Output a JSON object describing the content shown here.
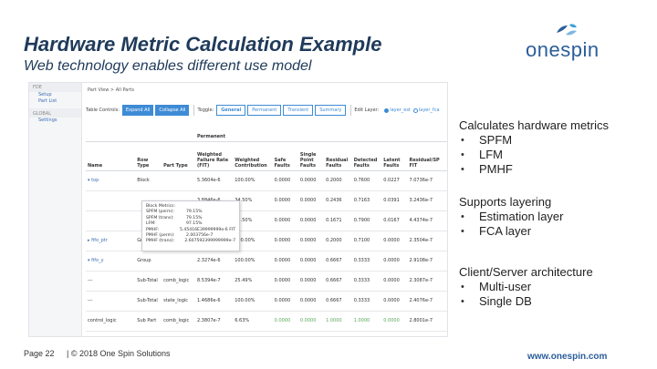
{
  "slide": {
    "title": "Hardware Metric Calculation Example",
    "subtitle": "Web technology enables different use model",
    "logo_text": "onespin",
    "footer_page": "Page  22",
    "footer_copy": "|  © 2018 One Spin Solutions",
    "footer_url": "www.onespin.com"
  },
  "right_panel": {
    "sections": [
      {
        "heading": "Calculates hardware metrics",
        "bullets": [
          "SPFM",
          "LFM",
          "PMHF"
        ]
      },
      {
        "heading": "Supports layering",
        "bullets": [
          "Estimation layer",
          "FCA  layer"
        ]
      },
      {
        "heading": "Client/Server architecture",
        "bullets": [
          "Multi-user",
          "Single DB"
        ]
      }
    ]
  },
  "app": {
    "sidebar": {
      "head": "FDE",
      "items": [
        "Setup",
        "Part List"
      ],
      "section": "GLOBAL",
      "items2": [
        "Settings"
      ]
    },
    "breadcrumb": "Part View  >  All Parts",
    "toolbar": {
      "controls_label": "Table Controls:",
      "expand_all": "Expand All",
      "collapse_all": "Collapse All",
      "toggle_label": "Toggle:",
      "toggles": [
        "General",
        "Permanent",
        "Transient",
        "Summary"
      ],
      "layer_label": "Edit Layer:",
      "layer_options": [
        "layer_est",
        "layer_fca"
      ]
    },
    "table": {
      "group_header": "Permanent",
      "columns": [
        "Name",
        "Row Type",
        "Part Type",
        "Weighted Failure Rate (FIT)",
        "Weighted Contribution",
        "Safe Faults",
        "Single Point Faults",
        "Residual Faults",
        "Detected Faults",
        "Latent Faults",
        "Residual/SP FIT"
      ],
      "rows": [
        [
          "▾  top",
          "Block",
          "",
          "5.3604e-6",
          "100.00%",
          "0.0000",
          "0.0000",
          "0.2000",
          "0.7600",
          "0.0227",
          "7.0736e-7"
        ],
        [
          "",
          "",
          "",
          "3.8846e-6",
          "34.50%",
          "0.0000",
          "0.0000",
          "0.2436",
          "0.7163",
          "0.0391",
          "3.2436e-7"
        ],
        [
          "",
          "",
          "",
          "3.6460e-6",
          "33.50%",
          "0.0000",
          "0.0000",
          "0.1671",
          "0.7900",
          "0.0167",
          "4.4374e-7"
        ],
        [
          "▸  fifo_ptr",
          "Group",
          "",
          "1.2476e-6",
          "100.00%",
          "0.0000",
          "0.0000",
          "0.2000",
          "0.7100",
          "0.0000",
          "2.3504e-7"
        ],
        [
          "▾  fifo_y",
          "Group",
          "",
          "2.3274e-6",
          "100.00%",
          "0.0000",
          "0.0000",
          "0.6667",
          "0.3333",
          "0.0000",
          "2.9108e-7"
        ],
        [
          "---",
          "Sub-Total",
          "comb_logic",
          "8.5394e-7",
          "25.49%",
          "0.0000",
          "0.0000",
          "0.6667",
          "0.3333",
          "0.0000",
          "2.3087e-7"
        ],
        [
          "---",
          "Sub-Total",
          "state_logic",
          "1.4686e-6",
          "100.00%",
          "0.0000",
          "0.0000",
          "0.6667",
          "0.3333",
          "0.0000",
          "2.4076e-7"
        ],
        [
          "control_logic",
          "Sub Part",
          "comb_logic",
          "2.3807e-7",
          "6.63%",
          "0.0000",
          "0.0000",
          "1.0000",
          "1.0000",
          "0.0000",
          "2.8001e-7"
        ]
      ]
    },
    "popup": [
      [
        "Block Metrics:",
        ""
      ],
      [
        "SPFM (perm):",
        "79.15%"
      ],
      [
        "SPFM (trans):",
        "79.15%"
      ],
      [
        "LFM:",
        "97.15%"
      ],
      [
        "PMHF:",
        "5.45416E39999999e-6 FIT"
      ],
      [
        "PMHF (perm):",
        "2.003756e-7"
      ],
      [
        "PMHF (trans):",
        "2.607592399999999e-7"
      ]
    ]
  }
}
